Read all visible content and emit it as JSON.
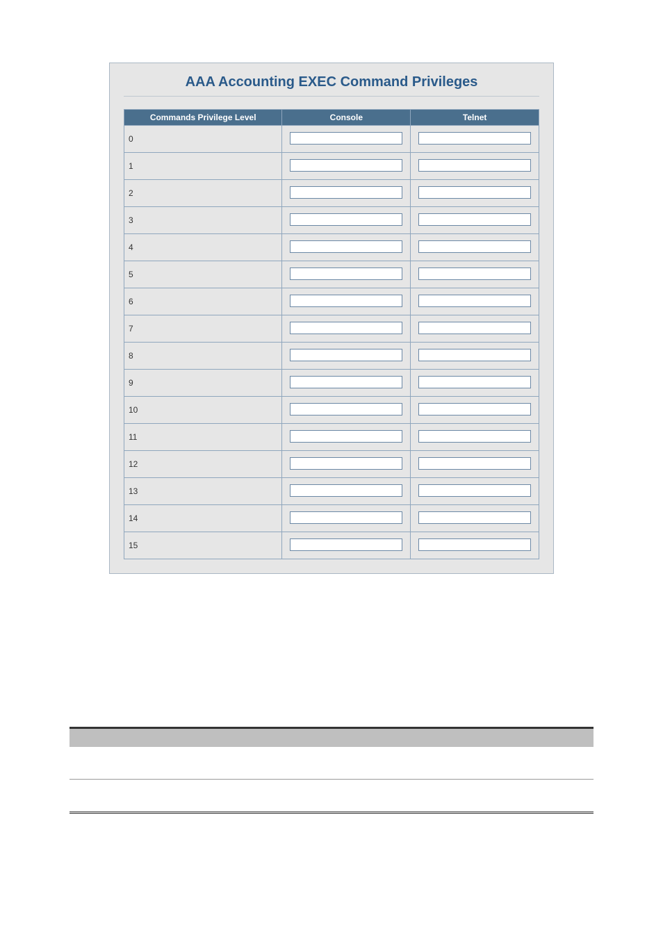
{
  "panel": {
    "title": "AAA Accounting EXEC Command Privileges",
    "headers": {
      "level": "Commands Privilege Level",
      "console": "Console",
      "telnet": "Telnet"
    },
    "rows": [
      {
        "level": "0",
        "console": "",
        "telnet": ""
      },
      {
        "level": "1",
        "console": "",
        "telnet": ""
      },
      {
        "level": "2",
        "console": "",
        "telnet": ""
      },
      {
        "level": "3",
        "console": "",
        "telnet": ""
      },
      {
        "level": "4",
        "console": "",
        "telnet": ""
      },
      {
        "level": "5",
        "console": "",
        "telnet": ""
      },
      {
        "level": "6",
        "console": "",
        "telnet": ""
      },
      {
        "level": "7",
        "console": "",
        "telnet": ""
      },
      {
        "level": "8",
        "console": "",
        "telnet": ""
      },
      {
        "level": "9",
        "console": "",
        "telnet": ""
      },
      {
        "level": "10",
        "console": "",
        "telnet": ""
      },
      {
        "level": "11",
        "console": "",
        "telnet": ""
      },
      {
        "level": "12",
        "console": "",
        "telnet": ""
      },
      {
        "level": "13",
        "console": "",
        "telnet": ""
      },
      {
        "level": "14",
        "console": "",
        "telnet": ""
      },
      {
        "level": "15",
        "console": "",
        "telnet": ""
      }
    ]
  }
}
